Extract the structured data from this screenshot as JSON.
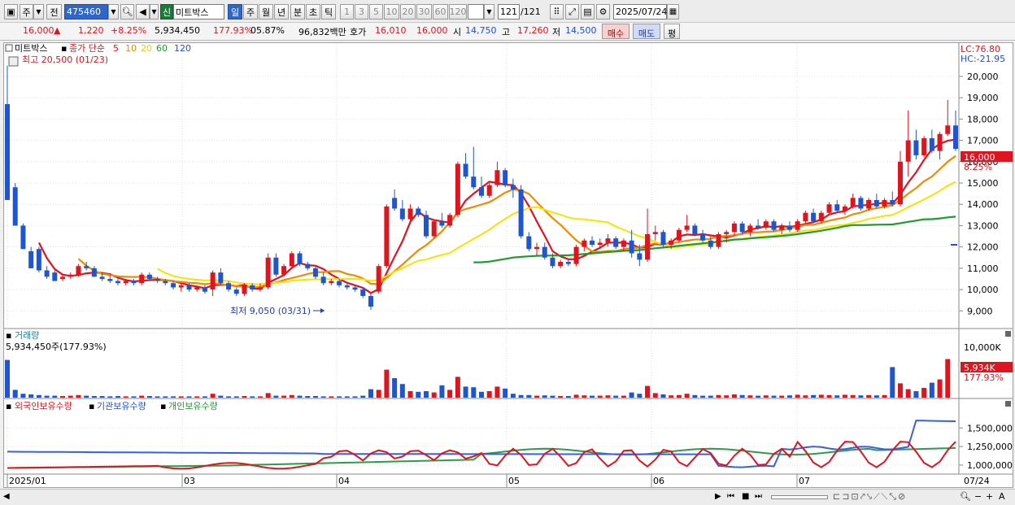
{
  "toolbar": {
    "market": "주",
    "prev": "전",
    "code": "475460",
    "new_badge": "신",
    "name": "미트박스",
    "periods": [
      "일",
      "주",
      "월",
      "년",
      "분",
      "초",
      "틱"
    ],
    "active_period": "일",
    "intervals": [
      "1",
      "3",
      "5",
      "10",
      "20",
      "30",
      "60",
      "120"
    ],
    "count": "121",
    "count_total": "/121",
    "date": "2025/07/24"
  },
  "quote": {
    "price": "16,000",
    "change_arrow": "▲",
    "change": "1,220",
    "change_pct": "+8.25%",
    "volume": "5,934,450",
    "volume_ratio": "177.93%",
    "turnover": "05.87%",
    "amount": "96,832백만",
    "ask_label": "호가",
    "ask1": "16,010",
    "ask2": "16,000",
    "open_label": "시",
    "open": "14,750",
    "high_label": "고",
    "high": "17,260",
    "low_label": "저",
    "low": "14,500",
    "buy": "매수",
    "sell": "매도",
    "eval": "평"
  },
  "price_panel": {
    "stock_label": "미트박스",
    "ma_label": "종가 단순",
    "ma_periods": [
      "5",
      "10",
      "20",
      "60",
      "120"
    ],
    "ma_colors": [
      "#e0141e",
      "#f08a00",
      "#f5e300",
      "#1e9a2e",
      "#1f4ed8"
    ],
    "max_note": "최고 20,500 (01/23)",
    "min_note": "최저 9,050 (03/31)",
    "lc": "LC:76.80",
    "hc": "HC:-21.95",
    "price_box": "16,000",
    "pct_box": "8.25%",
    "y_ticks": [
      "20,000",
      "19,000",
      "18,000",
      "17,000",
      "16,000",
      "15,000",
      "14,000",
      "13,000",
      "12,000",
      "11,000",
      "10,000",
      "9,000"
    ]
  },
  "volume_panel": {
    "title": "거래량",
    "value": "5,934,450주(177.93%)",
    "tick": "10,000K",
    "box": "5,934K",
    "box_pct": "177.93%"
  },
  "holding_panel": {
    "legend": [
      "외국인보유수량",
      "기관보유수량",
      "개인보유수량"
    ],
    "ticks": [
      "1,500,000",
      "1,250,000",
      "1,000,000"
    ]
  },
  "x_axis": {
    "labels": [
      "2025/01",
      "03",
      "04",
      "05",
      "06",
      "07"
    ],
    "right_label": "07/24"
  },
  "chart_data": {
    "type": "candlestick",
    "ylim": [
      8400,
      20800
    ],
    "candles": [
      [
        18700,
        20500,
        14200,
        14200
      ],
      [
        14800,
        15000,
        13000,
        13000
      ],
      [
        13000,
        13100,
        11900,
        11900
      ],
      [
        11800,
        12000,
        11000,
        11000
      ],
      [
        11900,
        12000,
        10800,
        10900
      ],
      [
        10900,
        11100,
        10500,
        10600
      ],
      [
        10800,
        10900,
        10400,
        10400
      ],
      [
        10500,
        10700,
        10400,
        10600
      ],
      [
        10600,
        10800,
        10500,
        10700
      ],
      [
        10700,
        11200,
        10600,
        11100
      ],
      [
        11100,
        11300,
        10900,
        11000
      ],
      [
        11000,
        11100,
        10600,
        10600
      ],
      [
        10600,
        10800,
        10400,
        10500
      ],
      [
        10500,
        10700,
        10300,
        10400
      ],
      [
        10400,
        10600,
        10200,
        10300
      ],
      [
        10300,
        10500,
        10200,
        10400
      ],
      [
        10400,
        10500,
        10200,
        10300
      ],
      [
        10300,
        10800,
        10200,
        10700
      ],
      [
        10700,
        10800,
        10400,
        10500
      ],
      [
        10500,
        10600,
        10300,
        10400
      ],
      [
        10400,
        10500,
        10200,
        10300
      ],
      [
        10300,
        10400,
        10000,
        10100
      ],
      [
        10100,
        10300,
        9900,
        10200
      ],
      [
        10200,
        10300,
        9900,
        10000
      ],
      [
        10000,
        10200,
        9900,
        10100
      ],
      [
        10100,
        10200,
        9800,
        9900
      ],
      [
        10000,
        10900,
        9700,
        10800
      ],
      [
        10800,
        11000,
        10200,
        10300
      ],
      [
        10300,
        10400,
        9900,
        10000
      ],
      [
        10000,
        10100,
        9700,
        9800
      ],
      [
        9800,
        10300,
        9700,
        10200
      ],
      [
        10200,
        10300,
        9900,
        10000
      ],
      [
        10000,
        10300,
        9900,
        10100
      ],
      [
        10100,
        11700,
        10000,
        11500
      ],
      [
        11500,
        11700,
        10600,
        10700
      ],
      [
        10700,
        11200,
        10600,
        11100
      ],
      [
        11100,
        11800,
        11000,
        11700
      ],
      [
        11700,
        11800,
        11100,
        11200
      ],
      [
        11200,
        11300,
        10900,
        11000
      ],
      [
        11000,
        11100,
        10500,
        10600
      ],
      [
        10600,
        10800,
        10200,
        10300
      ],
      [
        10300,
        10500,
        10200,
        10400
      ],
      [
        10400,
        10500,
        10100,
        10200
      ],
      [
        10200,
        10300,
        10000,
        10100
      ],
      [
        10100,
        10200,
        9900,
        10000
      ],
      [
        10000,
        10100,
        9600,
        9700
      ],
      [
        9700,
        9800,
        9050,
        9200
      ],
      [
        9900,
        11200,
        9800,
        11100
      ],
      [
        11100,
        14000,
        11000,
        13900
      ],
      [
        14300,
        14700,
        13700,
        13800
      ],
      [
        13800,
        14200,
        13200,
        13300
      ],
      [
        13300,
        14000,
        13200,
        13800
      ],
      [
        13800,
        13900,
        13400,
        13500
      ],
      [
        13500,
        13700,
        12400,
        12500
      ],
      [
        12500,
        13300,
        12400,
        13200
      ],
      [
        13200,
        13600,
        12900,
        13000
      ],
      [
        13000,
        13600,
        12900,
        13500
      ],
      [
        13500,
        16000,
        13400,
        15900
      ],
      [
        15900,
        16400,
        15200,
        15300
      ],
      [
        15300,
        16700,
        14700,
        14800
      ],
      [
        14800,
        15300,
        14300,
        14400
      ],
      [
        14400,
        15000,
        14300,
        14900
      ],
      [
        14900,
        16000,
        14800,
        15600
      ],
      [
        15600,
        15700,
        14800,
        14900
      ],
      [
        14900,
        15200,
        14300,
        14700
      ],
      [
        14700,
        14900,
        12400,
        12500
      ],
      [
        12500,
        12700,
        11800,
        11900
      ],
      [
        11900,
        12200,
        11600,
        12000
      ],
      [
        12000,
        12200,
        11400,
        11500
      ],
      [
        11500,
        11700,
        11000,
        11100
      ],
      [
        11100,
        11400,
        11000,
        11300
      ],
      [
        11300,
        11400,
        11100,
        11200
      ],
      [
        11200,
        12100,
        11100,
        12000
      ],
      [
        12000,
        12400,
        11800,
        12300
      ],
      [
        12300,
        12500,
        12000,
        12100
      ],
      [
        12100,
        12400,
        11900,
        12200
      ],
      [
        12200,
        12600,
        12000,
        12400
      ],
      [
        12400,
        12500,
        11900,
        12000
      ],
      [
        12000,
        12400,
        11800,
        12300
      ],
      [
        12300,
        12800,
        11500,
        11700
      ],
      [
        11700,
        12100,
        11100,
        11400
      ],
      [
        11400,
        13800,
        11300,
        12600
      ],
      [
        12600,
        13000,
        12300,
        12700
      ],
      [
        12700,
        12800,
        12000,
        12100
      ],
      [
        12100,
        12400,
        11900,
        12300
      ],
      [
        12300,
        12900,
        12200,
        12800
      ],
      [
        12800,
        13500,
        12700,
        13000
      ],
      [
        13000,
        13100,
        12500,
        12600
      ],
      [
        12600,
        12800,
        12200,
        12300
      ],
      [
        12300,
        12500,
        11900,
        12000
      ],
      [
        12000,
        12700,
        11900,
        12600
      ],
      [
        12600,
        12800,
        12200,
        12700
      ],
      [
        12700,
        13200,
        12500,
        13100
      ],
      [
        13100,
        13200,
        12600,
        12700
      ],
      [
        12700,
        13100,
        12500,
        13000
      ],
      [
        13000,
        13300,
        12800,
        12900
      ],
      [
        12900,
        13300,
        12800,
        13200
      ],
      [
        13200,
        13300,
        12700,
        12800
      ],
      [
        12800,
        13100,
        12600,
        13000
      ],
      [
        13000,
        13200,
        12700,
        12800
      ],
      [
        12800,
        13300,
        12700,
        13200
      ],
      [
        13200,
        13700,
        13100,
        13600
      ],
      [
        13600,
        13800,
        13100,
        13200
      ],
      [
        13200,
        13700,
        13100,
        13600
      ],
      [
        13600,
        14100,
        13500,
        14000
      ],
      [
        14000,
        14200,
        13600,
        13700
      ],
      [
        13700,
        14000,
        13500,
        13900
      ],
      [
        13900,
        14500,
        13800,
        14300
      ],
      [
        14300,
        14400,
        13700,
        13800
      ],
      [
        13800,
        14300,
        13700,
        14200
      ],
      [
        14200,
        14500,
        13800,
        13900
      ],
      [
        13900,
        14300,
        13800,
        14200
      ],
      [
        14200,
        14600,
        13900,
        14000
      ],
      [
        14000,
        16500,
        13900,
        16000
      ],
      [
        16000,
        18400,
        15300,
        17000
      ],
      [
        17000,
        17500,
        16100,
        16300
      ],
      [
        16300,
        17200,
        16200,
        17100
      ],
      [
        17100,
        17500,
        16400,
        16500
      ],
      [
        16500,
        17400,
        16100,
        17300
      ],
      [
        17300,
        18900,
        17200,
        17700
      ],
      [
        17700,
        18400,
        16500,
        16600
      ]
    ],
    "volume": [
      5800,
      1200,
      600,
      500,
      400,
      300,
      300,
      250,
      300,
      400,
      300,
      250,
      250,
      200,
      250,
      200,
      200,
      300,
      250,
      200,
      200,
      200,
      200,
      200,
      200,
      200,
      600,
      300,
      200,
      200,
      250,
      200,
      200,
      700,
      300,
      300,
      400,
      300,
      250,
      250,
      200,
      200,
      200,
      200,
      200,
      300,
      1300,
      1200,
      4300,
      3000,
      2100,
      1000,
      900,
      1000,
      800,
      1900,
      1200,
      3200,
      1700,
      1600,
      900,
      1000,
      1700,
      1400,
      600,
      400,
      400,
      300,
      350,
      300,
      250,
      250,
      450,
      350,
      300,
      300,
      350,
      300,
      300,
      800,
      600,
      1800,
      700,
      500,
      350,
      400,
      600,
      400,
      300,
      300,
      400,
      350,
      500,
      400,
      350,
      300,
      350,
      300,
      300,
      350,
      450,
      350,
      400,
      450,
      400,
      350,
      450,
      400,
      350,
      400,
      350,
      400,
      4700,
      2200,
      1300,
      1000,
      1500,
      2300,
      2800,
      5934
    ],
    "volume_ylim": [
      0,
      10000
    ],
    "holdings_ylim": [
      900000,
      1700000
    ]
  }
}
